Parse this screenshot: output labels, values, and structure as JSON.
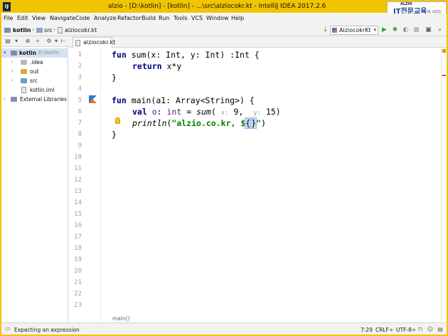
{
  "window": {
    "title": "alzio - [D:\\kotlin] - [kotlin] - ...\\src\\alziocokr.kt - IntelliJ IDEA 2017.2.6",
    "app_icon": "IJ",
    "brand_top": "ALZIO",
    "brand_main": "IT전문교육",
    "brand_sub": "의 리더!"
  },
  "menu": [
    "File",
    "Edit",
    "View",
    "Navigate",
    "Code",
    "Analyze",
    "Refactor",
    "Build",
    "Run",
    "Tools",
    "VCS",
    "Window",
    "Help"
  ],
  "breadcrumbs": [
    "kotlin",
    "src",
    "alziocokr.kt"
  ],
  "run_config": "AlziocokrKt",
  "editor_tab": "alziocokr.kt",
  "tree": [
    {
      "label": "kotlin",
      "hint": "D:\\kotlin"
    },
    {
      "label": ".idea"
    },
    {
      "label": "out"
    },
    {
      "label": "src"
    },
    {
      "label": "kotlin.iml"
    },
    {
      "label": "External Libraries"
    }
  ],
  "line_numbers": [
    "1",
    "2",
    "3",
    "4",
    "5",
    "6",
    "7",
    "8",
    "9",
    "10",
    "11",
    "12",
    "13",
    "14",
    "15",
    "16",
    "17",
    "18",
    "19",
    "20",
    "21",
    "22",
    "23"
  ],
  "code": {
    "l1_kw": "fun",
    "l1_rest": " sum(x: Int, y: Int) :Int {",
    "l2_kw": "return",
    "l2_rest": " x*y",
    "l3": "}",
    "l5_kw": "fun",
    "l5_rest": " main(a1: Array<String>) {",
    "l6_kw": "val",
    "l6_var": "o",
    "l6_mid": ": ",
    "l6_type": "int",
    "l6_eq": " = ",
    "l6_fn": "sum",
    "l6_open": "( ",
    "l6_h1": "x:",
    "l6_a1": " 9,  ",
    "l6_h2": "y:",
    "l6_a2": " 15)",
    "l7_fn": "println",
    "l7_open": "(",
    "l7_str": "\"alzio.co.kr, $",
    "l7_brace_open": "{",
    "l7_brace_close": "}",
    "l7_end_str": "\"",
    "l7_close": ")",
    "l8": "}"
  },
  "editor_crumb": "main()",
  "status": {
    "message": "Expecting an expression",
    "position": "7:29",
    "line_sep": "CRLF÷",
    "encoding": "UTF-8÷"
  }
}
